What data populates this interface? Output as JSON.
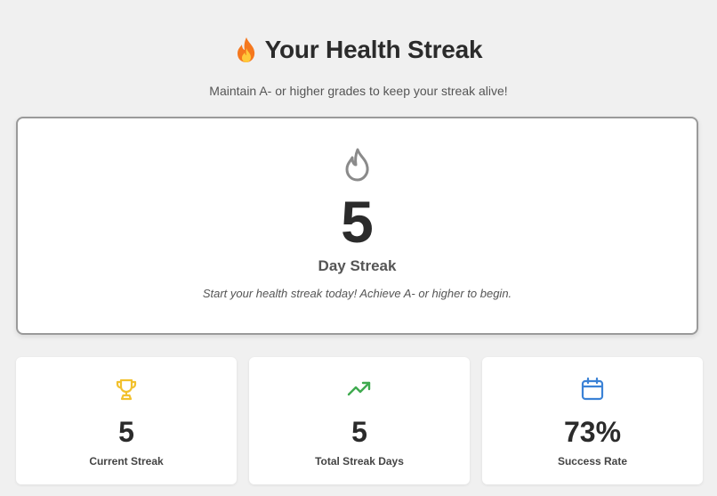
{
  "header": {
    "title": "Your Health Streak",
    "title_icon": "fire-emoji-icon",
    "subtitle": "Maintain A- or higher grades to keep your streak alive!"
  },
  "hero": {
    "icon": "flame-outline-icon",
    "streak_value": "5",
    "streak_label": "Day Streak",
    "message": "Start your health streak today! Achieve A- or higher to begin."
  },
  "stats": [
    {
      "icon": "trophy-icon",
      "value": "5",
      "label": "Current Streak",
      "color": "#f2c12e"
    },
    {
      "icon": "trending-up-icon",
      "value": "5",
      "label": "Total Streak Days",
      "color": "#3faa4f"
    },
    {
      "icon": "calendar-icon",
      "value": "73%",
      "label": "Success Rate",
      "color": "#3b82d6"
    }
  ],
  "colors": {
    "background": "#f0f0f0",
    "card": "#ffffff",
    "hero_border": "#9a9a9a",
    "text_dark": "#2b2b2b",
    "flame_outline": "#8a8a8a"
  }
}
